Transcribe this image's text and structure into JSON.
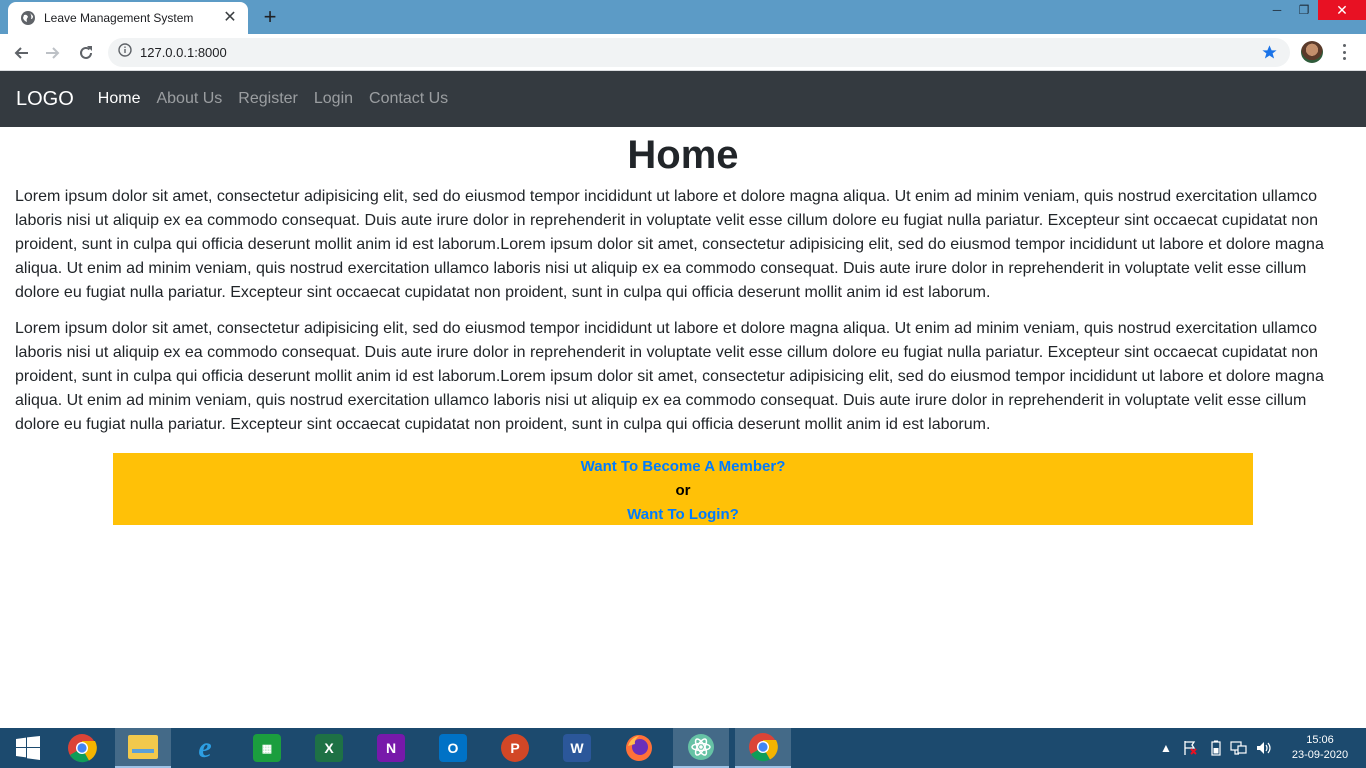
{
  "browser": {
    "tab_title": "Leave Management System",
    "url": "127.0.0.1:8000"
  },
  "navbar": {
    "brand": "LOGO",
    "links": [
      "Home",
      "About Us",
      "Register",
      "Login",
      "Contact Us"
    ]
  },
  "page": {
    "title": "Home",
    "paragraph1": "Lorem ipsum dolor sit amet, consectetur adipisicing elit, sed do eiusmod tempor incididunt ut labore et dolore magna aliqua. Ut enim ad minim veniam, quis nostrud exercitation ullamco laboris nisi ut aliquip ex ea commodo consequat. Duis aute irure dolor in reprehenderit in voluptate velit esse cillum dolore eu fugiat nulla pariatur. Excepteur sint occaecat cupidatat non proident, sunt in culpa qui officia deserunt mollit anim id est laborum.Lorem ipsum dolor sit amet, consectetur adipisicing elit, sed do eiusmod tempor incididunt ut labore et dolore magna aliqua. Ut enim ad minim veniam, quis nostrud exercitation ullamco laboris nisi ut aliquip ex ea commodo consequat. Duis aute irure dolor in reprehenderit in voluptate velit esse cillum dolore eu fugiat nulla pariatur. Excepteur sint occaecat cupidatat non proident, sunt in culpa qui officia deserunt mollit anim id est laborum.",
    "paragraph2": "Lorem ipsum dolor sit amet, consectetur adipisicing elit, sed do eiusmod tempor incididunt ut labore et dolore magna aliqua. Ut enim ad minim veniam, quis nostrud exercitation ullamco laboris nisi ut aliquip ex ea commodo consequat. Duis aute irure dolor in reprehenderit in voluptate velit esse cillum dolore eu fugiat nulla pariatur. Excepteur sint occaecat cupidatat non proident, sunt in culpa qui officia deserunt mollit anim id est laborum.Lorem ipsum dolor sit amet, consectetur adipisicing elit, sed do eiusmod tempor incididunt ut labore et dolore magna aliqua. Ut enim ad minim veniam, quis nostrud exercitation ullamco laboris nisi ut aliquip ex ea commodo consequat. Duis aute irure dolor in reprehenderit in voluptate velit esse cillum dolore eu fugiat nulla pariatur. Excepteur sint occaecat cupidatat non proident, sunt in culpa qui officia deserunt mollit anim id est laborum."
  },
  "cta": {
    "member_link": "Want To Become A Member?",
    "or_text": "or",
    "login_link": "Want To Login?"
  },
  "taskbar": {
    "apps": [
      "start-icon",
      "chrome-icon",
      "file-explorer-icon",
      "internet-explorer-icon",
      "microsoft-store-icon",
      "excel-icon",
      "onenote-icon",
      "outlook-icon",
      "powerpoint-icon",
      "word-icon",
      "firefox-icon",
      "atom-icon",
      "chrome-icon"
    ],
    "time": "15:06",
    "date": "23-09-2020"
  },
  "colors": {
    "navbar_bg": "#343a40",
    "cta_bg": "#ffc107",
    "link": "#007bff",
    "tabstrip": "#5c9bc6",
    "taskbar": "#1c4a6e"
  }
}
